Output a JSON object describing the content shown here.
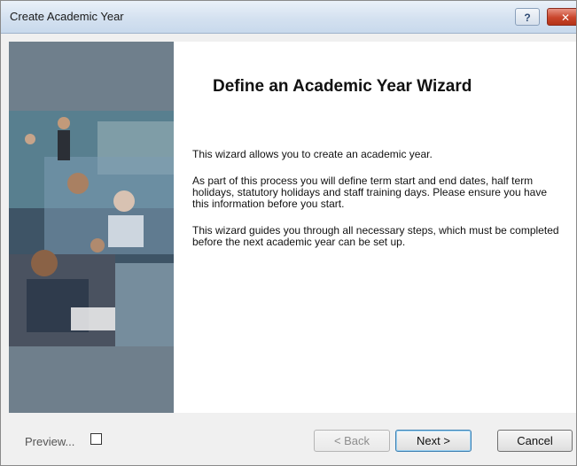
{
  "window": {
    "title": "Create Academic Year",
    "help_glyph": "?",
    "close_glyph": "✕"
  },
  "main": {
    "heading": "Define an Academic Year Wizard",
    "paragraphs": [
      "This wizard allows you to create an academic year.",
      "As part of this process you will define term start and end dates, half term holidays, statutory holidays and staff training days. Please ensure you have this information before you start.",
      "This wizard guides you through all necessary steps, which must be completed before the next academic year can be set up."
    ]
  },
  "footer": {
    "preview_label": "Preview...",
    "preview_checked": false,
    "back_label": "< Back",
    "next_label": "Next >",
    "cancel_label": "Cancel"
  },
  "icons": {
    "help": "help-icon",
    "close": "close-icon"
  },
  "colors": {
    "side_panel": "#6f7f8c",
    "title_bar": "#d4e1f0",
    "close_button": "#c9452c"
  }
}
